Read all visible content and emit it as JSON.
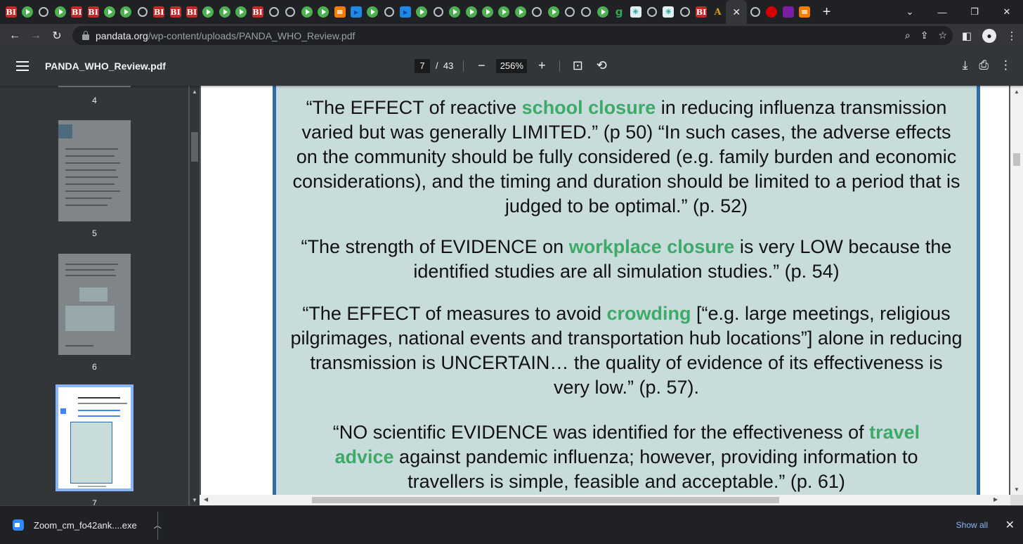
{
  "browser": {
    "tabs": [
      "bi",
      "play",
      "globe",
      "play",
      "bi",
      "bi",
      "play",
      "play",
      "globe",
      "bi",
      "bi",
      "bi",
      "play",
      "play",
      "play",
      "bi",
      "globe",
      "globe",
      "play",
      "play",
      "rss",
      "blue",
      "play",
      "globe",
      "blue",
      "play",
      "globe",
      "play",
      "play",
      "play",
      "play",
      "play",
      "globe",
      "play",
      "globe",
      "globe",
      "play",
      "g",
      "grid",
      "globe",
      "grid",
      "globe",
      "bi",
      "a",
      "close",
      "globe",
      "red",
      "mail",
      "rss"
    ],
    "tab_letters": {
      "bi": "BI",
      "g": "g",
      "a": "A"
    },
    "new_tab": "+",
    "url_host": "pandata.org",
    "url_path": "/wp-content/uploads/PANDA_WHO_Review.pdf"
  },
  "pdf": {
    "title": "PANDA_WHO_Review.pdf",
    "current_page": "7",
    "page_sep": "/",
    "total_pages": "43",
    "zoom": "256%"
  },
  "thumbnails": [
    {
      "label": "4"
    },
    {
      "label": "5"
    },
    {
      "label": "6"
    },
    {
      "label": "7"
    }
  ],
  "quotes": [
    {
      "parts": [
        {
          "t": "“The EFFECT of reactive "
        },
        {
          "t": "school closure",
          "hl": true
        },
        {
          "t": " in reducing influenza transmission varied but was generally LIMITED.” (p 50) “In such cases, the adverse effects on the community should be fully considered (e.g. family burden and economic considerations), and the timing and duration should be limited to a period that is judged to be optimal.” (p. 52)"
        }
      ]
    },
    {
      "parts": [
        {
          "t": "“The strength of EVIDENCE on "
        },
        {
          "t": "workplace closure",
          "hl": true
        },
        {
          "t": " is very LOW because the identified studies are all simulation studies.” (p. 54)"
        }
      ]
    },
    {
      "parts": [
        {
          "t": "“The EFFECT of measures to avoid "
        },
        {
          "t": "crowding",
          "hl": true
        },
        {
          "t": "  [“e.g. large meetings, religious pilgrimages, national events and transportation hub locations”] alone in reducing transmission is UNCERTAIN… the quality of evidence of its effectiveness is very low.” (p. 57)."
        }
      ]
    },
    {
      "parts": [
        {
          "t": "“NO scientific EVIDENCE was identified for the effectiveness of "
        },
        {
          "t": "travel advice",
          "hl": true
        },
        {
          "t": " against pandemic influenza; however, providing information to travellers is simple, feasible and acceptable.” (p. 61)"
        }
      ]
    }
  ],
  "download": {
    "filename": "Zoom_cm_fo42ank....exe",
    "show_all": "Show all"
  },
  "colors": {
    "highlight": "#3daa68",
    "panel": "#c9dcdc",
    "panel_border": "#2f6ea4"
  }
}
